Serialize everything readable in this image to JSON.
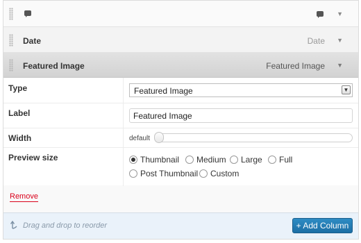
{
  "columns": [
    {
      "title": "",
      "type_label": ""
    },
    {
      "title": "Date",
      "type_label": "Date"
    },
    {
      "title": "Featured Image",
      "type_label": "Featured Image"
    }
  ],
  "settings": {
    "type_label": "Type",
    "type_value": "Featured Image",
    "label_label": "Label",
    "label_value": "Featured Image",
    "width_label": "Width",
    "width_default": "default",
    "width_fraction": 0,
    "preview_label": "Preview size",
    "preview_options": [
      "Thumbnail",
      "Medium",
      "Large",
      "Full",
      "Post Thumbnail",
      "Custom"
    ],
    "preview_selected": "Thumbnail"
  },
  "remove_label": "Remove",
  "footer": {
    "hint": "Drag and drop to reorder",
    "add_button": "+ Add Column"
  },
  "colors": {
    "accent": "#2e8cc4",
    "remove": "#d9001a"
  }
}
